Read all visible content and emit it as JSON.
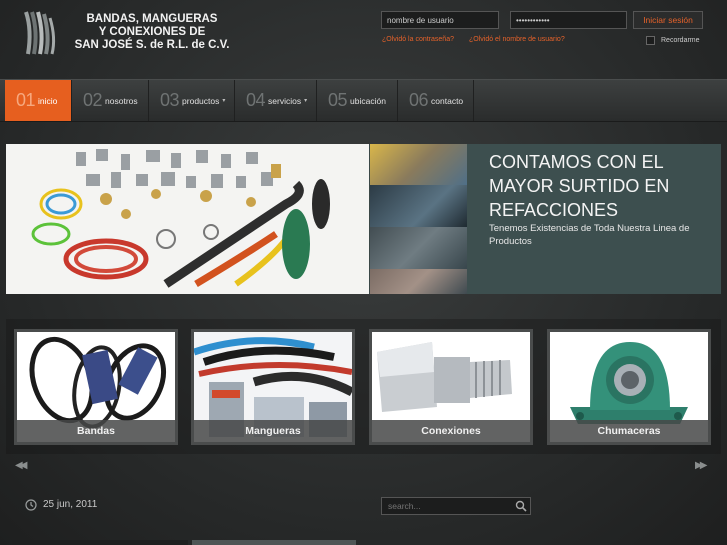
{
  "logo": {
    "line1": "BANDAS, MANGUERAS",
    "line2": "Y CONEXIONES DE",
    "line3": "SAN JOSÉ S. de R.L. de C.V."
  },
  "login": {
    "username_value": "nombre de usuario",
    "password_value": "••••••••••••",
    "submit_label": "Iniciar sesión",
    "forgot_password": "¿Olvidó la contraseña?",
    "forgot_username": "¿Olvidó el nombre de usuario?",
    "remember_label": "Recordarme"
  },
  "nav": {
    "items": [
      {
        "num": "01",
        "label": "inicio",
        "dropdown": false,
        "active": true
      },
      {
        "num": "02",
        "label": "nosotros",
        "dropdown": false,
        "active": false
      },
      {
        "num": "03",
        "label": "productos",
        "dropdown": true,
        "active": false
      },
      {
        "num": "04",
        "label": "servicios",
        "dropdown": true,
        "active": false
      },
      {
        "num": "05",
        "label": "ubicación",
        "dropdown": false,
        "active": false
      },
      {
        "num": "06",
        "label": "contacto",
        "dropdown": false,
        "active": false
      }
    ],
    "caret": "▾"
  },
  "slider": {
    "headline": "CONTAMOS CON EL MAYOR SURTIDO EN REFACCIONES",
    "subtext": "Tenemos Existencias de Toda Nuestra Linea de Productos"
  },
  "products": {
    "cards": [
      {
        "caption": "Bandas"
      },
      {
        "caption": "Mangueras"
      },
      {
        "caption": "Conexiones"
      },
      {
        "caption": "Chumaceras"
      }
    ],
    "prev_arrow": "◀◀",
    "next_arrow": "▶▶"
  },
  "footer": {
    "date": "25 jun, 2011",
    "search_placeholder": "search..."
  },
  "colors": {
    "accent": "#e65f1f",
    "background": "#2a2c2c",
    "slide_panel": "#3e5050"
  }
}
